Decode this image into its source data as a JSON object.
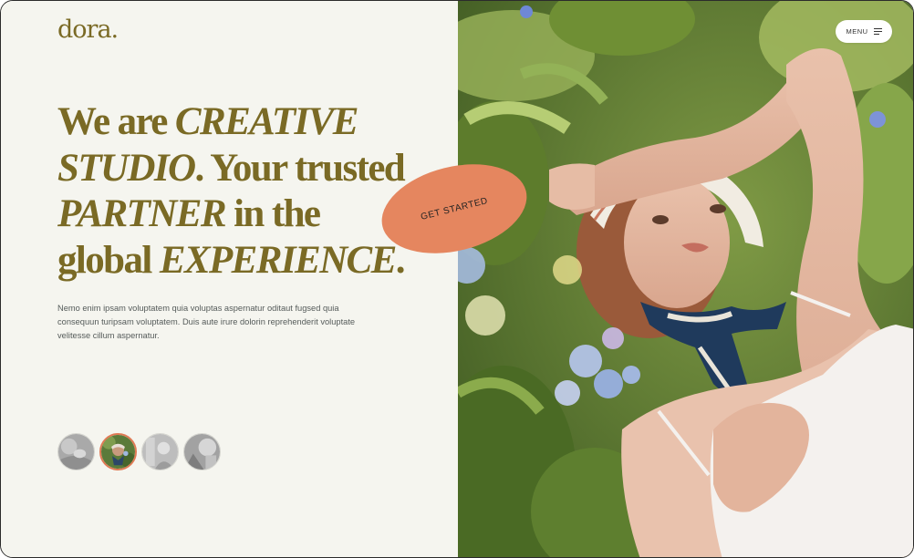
{
  "brand": {
    "logo": "dora."
  },
  "hero": {
    "line1_a": "We are ",
    "line1_b": "CREATIVE",
    "line2_a": "STUDIO",
    "line2_b": ". Your trusted",
    "line3_a": "PARTNER",
    "line3_b": " in the",
    "line4_a": "global ",
    "line4_b": "EXPERIENCE",
    "line4_c": ".",
    "body": "Nemo enim ipsam voluptatem quia voluptas aspernatur oditaut fugsed quia consequun turipsam voluptatem. Duis aute irure dolorin reprehenderit voluptate velitesse cillum aspernatur."
  },
  "cta": {
    "label": "GET STARTED"
  },
  "menu": {
    "label": "MENU"
  },
  "colors": {
    "background": "#f5f5ef",
    "heading": "#7a6a25",
    "accent": "#e5865f",
    "body_text": "#555b5a"
  },
  "icons": {
    "menu": "hamburger-icon"
  },
  "thumbnails": {
    "count": 4,
    "active_index": 1
  }
}
